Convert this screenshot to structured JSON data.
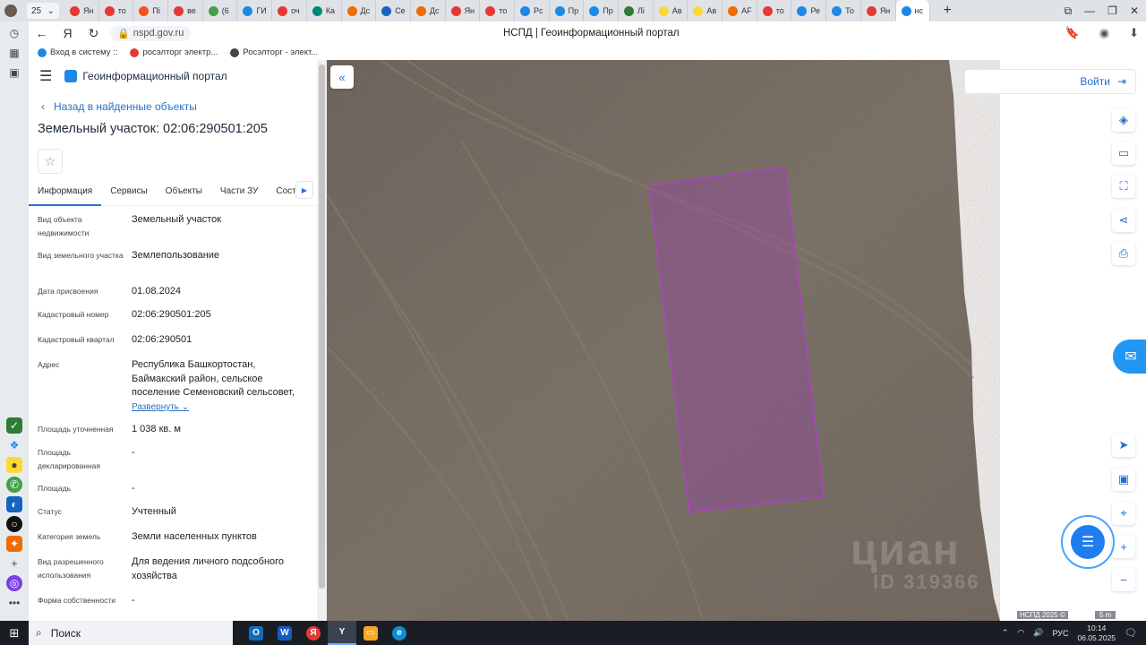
{
  "browser": {
    "tab_count": "25",
    "tabs": [
      {
        "label": "Ян",
        "color": "#e53935"
      },
      {
        "label": "то",
        "color": "#e53935"
      },
      {
        "label": "Пі",
        "color": "#f4511e"
      },
      {
        "label": "ве",
        "color": "#e53935"
      },
      {
        "label": "(6",
        "color": "#43a047"
      },
      {
        "label": "ГИ",
        "color": "#1e88e5"
      },
      {
        "label": "оч",
        "color": "#e53935"
      },
      {
        "label": "Ка",
        "color": "#00897b"
      },
      {
        "label": "Дс",
        "color": "#ef6c00"
      },
      {
        "label": "Се",
        "color": "#1565c0"
      },
      {
        "label": "Дс",
        "color": "#ef6c00"
      },
      {
        "label": "Ян",
        "color": "#e53935"
      },
      {
        "label": "то",
        "color": "#e53935"
      },
      {
        "label": "Рс",
        "color": "#1e88e5"
      },
      {
        "label": "Пр",
        "color": "#1e88e5"
      },
      {
        "label": "Пр",
        "color": "#1e88e5"
      },
      {
        "label": "Лі",
        "color": "#2e7d32"
      },
      {
        "label": "Ав",
        "color": "#fdd835"
      },
      {
        "label": "Ав",
        "color": "#fdd835"
      },
      {
        "label": "AF",
        "color": "#ef6c00"
      },
      {
        "label": "то",
        "color": "#e53935"
      },
      {
        "label": "Ре",
        "color": "#1e88e5"
      },
      {
        "label": "То",
        "color": "#1e88e5"
      },
      {
        "label": "Ян",
        "color": "#e53935"
      },
      {
        "label": "нс",
        "color": "#1e88e5"
      }
    ],
    "url": "nspd.gov.ru",
    "page_title": "НСПД | Геоинформационный портал",
    "bookmarks": [
      {
        "label": "Вход в систему ::",
        "color": "#1e88e5"
      },
      {
        "label": "росэлторг электр...",
        "color": "#e53935"
      },
      {
        "label": "Росэлторг - элект...",
        "color": "#444444"
      }
    ]
  },
  "panel": {
    "app_name": "Геоинформационный портал",
    "back_label": "Назад в найденные объекты",
    "title": "Земельный участок: 02:06:290501:205",
    "tabs": [
      "Информация",
      "Сервисы",
      "Объекты",
      "Части ЗУ",
      "Соста"
    ],
    "active_tab": "Информация",
    "rows": [
      {
        "label": "Вид объекта недвижимости",
        "value": "Земельный участок"
      },
      {
        "label": "Вид земельного участка",
        "value": "Землепользование"
      },
      {
        "label": "Дата присвоения",
        "value": "01.08.2024"
      },
      {
        "label": "Кадастровый номер",
        "value": "02:06:290501:205"
      },
      {
        "label": "Кадастровый квартал",
        "value": "02:06:290501"
      },
      {
        "label": "Адрес",
        "value": "Республика Башкортостан, Баймакский район, сельское поселение Семеновский сельсовет,"
      },
      {
        "label": "Площадь уточненная",
        "value": "1 038 кв. м"
      },
      {
        "label": "Площадь декларированная",
        "value": "-"
      },
      {
        "label": "Площадь",
        "value": "-"
      },
      {
        "label": "Статус",
        "value": "Учтенный"
      },
      {
        "label": "Категория земель",
        "value": "Земли населенных пунктов"
      },
      {
        "label": "Вид разрешенного использования",
        "value": "Для ведения личного подсобного хозяйства"
      },
      {
        "label": "Форма собственности",
        "value": "-"
      }
    ],
    "expand_label": "Развернуть"
  },
  "map": {
    "login_label": "Войти",
    "copyright": "НСПД 2025 ©",
    "scale_label": "5 m",
    "watermark": "циан",
    "watermark_id": "ID 319366",
    "parcel_color": "#a03ab4"
  },
  "taskbar": {
    "search_label": "Поиск",
    "lang": "РУС",
    "time": "10:14",
    "date": "06.05.2025",
    "notif_count": "1"
  }
}
